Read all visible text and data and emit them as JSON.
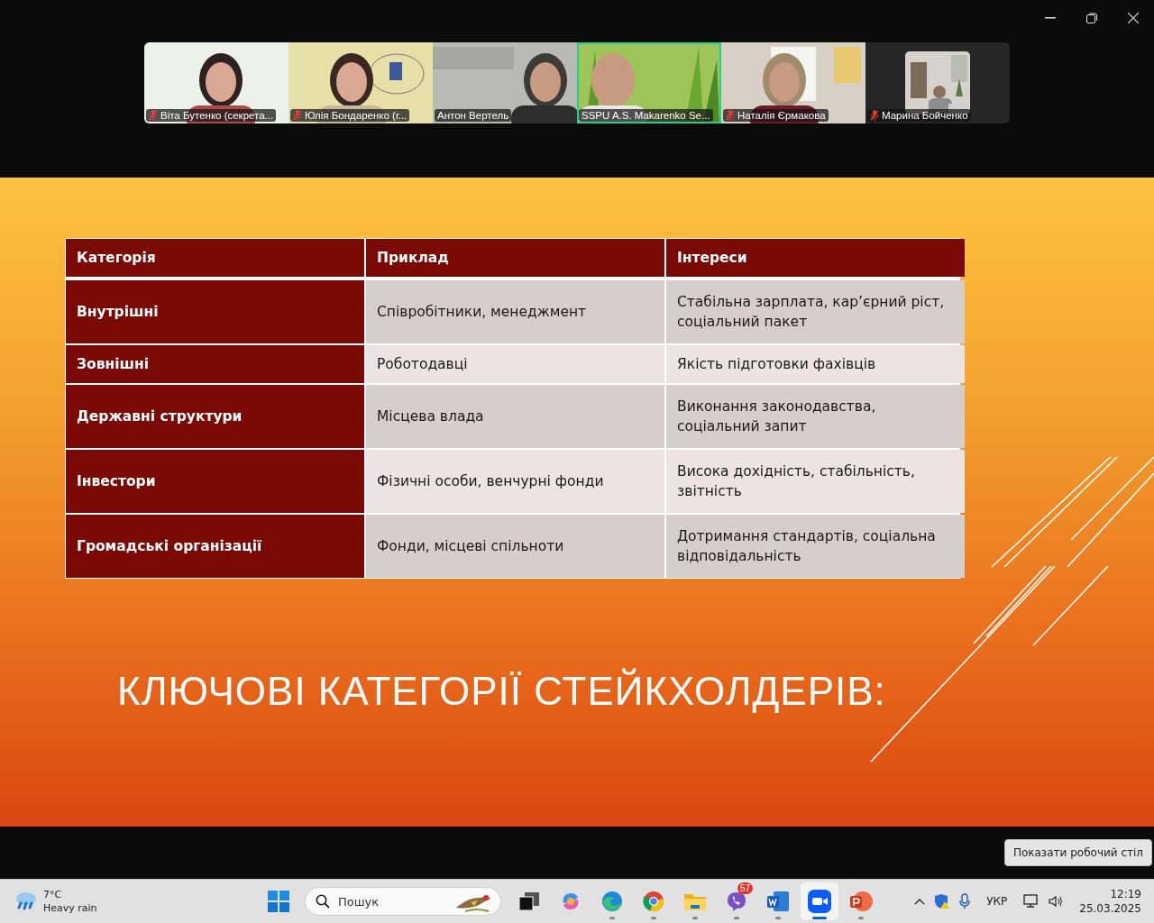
{
  "window_controls": [
    {
      "kind": "minimize"
    },
    {
      "kind": "restore"
    },
    {
      "kind": "close"
    }
  ],
  "participants": [
    {
      "name": "Віта Бутенко (секрета...",
      "muted": true,
      "speaking": false,
      "kind": "full"
    },
    {
      "name": "Юлія Бондаренко (г...",
      "muted": true,
      "speaking": false,
      "kind": "full"
    },
    {
      "name": "Антон Вертель",
      "muted": false,
      "speaking": false,
      "kind": "full"
    },
    {
      "name": "SSPU A.S. Makarenko Se...",
      "muted": false,
      "speaking": true,
      "kind": "full"
    },
    {
      "name": "Наталія  Єрмакова",
      "muted": true,
      "speaking": false,
      "kind": "full"
    },
    {
      "name": "Марина Бойченко",
      "muted": true,
      "speaking": false,
      "kind": "inset"
    }
  ],
  "slide": {
    "table": {
      "columns": [
        "Категорія",
        "Приклад",
        "Інтереси"
      ],
      "rows": [
        [
          "Внутрішні",
          "Співробітники, менеджмент",
          "Стабільна зарплата, кар’єрний ріст, соціальний пакет"
        ],
        [
          "Зовнішні",
          "Роботодавці",
          "Якість підготовки фахівців"
        ],
        [
          "Державні структури",
          "Місцева влада",
          "Виконання законодавства, соціальний запит"
        ],
        [
          "Інвестори",
          "Фізичні особи, венчурні фонди",
          "Висока дохідність, стабільність, звітність"
        ],
        [
          "Громадські організації",
          "Фонди, місцеві спільноти",
          "Дотримання стандартів, соціальна відповідальність"
        ]
      ]
    },
    "title": "КЛЮЧОВІ КАТЕГОРІЇ СТЕЙКХОЛДЕРІВ:"
  },
  "tooltip": "Показати робочий стіл",
  "taskbar": {
    "weather": {
      "temperature": "7°C",
      "condition": "Heavy rain"
    },
    "search": {
      "placeholder": "Пошук"
    },
    "apps": [
      {
        "kind": "taskview",
        "running": false,
        "active": false
      },
      {
        "kind": "copilot",
        "running": false,
        "active": false
      },
      {
        "kind": "edge",
        "running": true,
        "active": false
      },
      {
        "kind": "chrome",
        "running": true,
        "active": false
      },
      {
        "kind": "explorer",
        "running": true,
        "active": false
      },
      {
        "kind": "viber",
        "running": true,
        "active": false,
        "badge": "57"
      },
      {
        "kind": "word",
        "running": true,
        "active": false
      },
      {
        "kind": "zoom",
        "running": true,
        "active": true
      },
      {
        "kind": "powerpoint",
        "running": true,
        "active": false
      }
    ],
    "language": "УКР",
    "time": "12:19",
    "date": "25.03.2025"
  }
}
